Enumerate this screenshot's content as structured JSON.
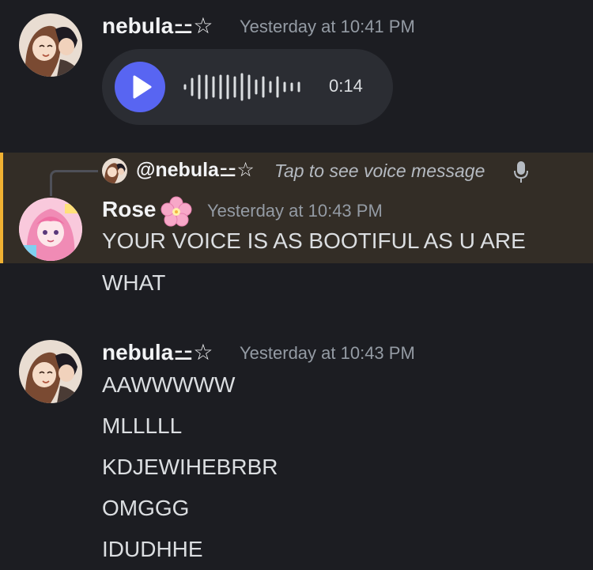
{
  "messages": [
    {
      "author": "nebula⚍☆",
      "timestamp": "Yesterday at 10:41 PM",
      "voice_message": {
        "duration": "0:14"
      }
    },
    {
      "reply": {
        "author": "@nebula⚍☆",
        "preview": "Tap to see voice message",
        "icon": "microphone-icon"
      },
      "author": "Rose",
      "author_badge_icon": "cherry-blossom-icon",
      "timestamp": "Yesterday at 10:43 PM",
      "lines": [
        "YOUR VOICE IS AS BOOTIFUL AS U ARE",
        "WHAT"
      ],
      "highlighted": true
    },
    {
      "author": "nebula⚍☆",
      "timestamp": "Yesterday at 10:43 PM",
      "lines": [
        "AAWWWWW",
        "MLLLLL",
        "KDJEWIHEBRBR",
        "OMGGG",
        "IDUDHHE"
      ]
    }
  ],
  "colors": {
    "background": "#1c1d22",
    "highlight_bg": "#332d26",
    "highlight_bar": "#f0b132",
    "play_button": "#5865f2",
    "voice_bubble": "#2b2d33"
  }
}
